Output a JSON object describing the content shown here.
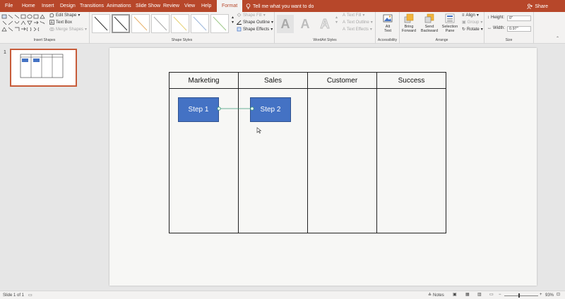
{
  "menu": {
    "tabs": [
      "File",
      "Home",
      "Insert",
      "Design",
      "Transitions",
      "Animations",
      "Slide Show",
      "Review",
      "View",
      "Help"
    ],
    "active_tab": "Format",
    "tell_me": "Tell me what you want to do",
    "share": "Share"
  },
  "ribbon": {
    "insert_shapes": {
      "label": "Insert Shapes",
      "edit_shape": "Edit Shape",
      "text_box": "Text Box",
      "merge_shapes": "Merge Shapes"
    },
    "shape_styles": {
      "label": "Shape Styles",
      "fill": "Shape Fill",
      "outline": "Shape Outline",
      "effects": "Shape Effects"
    },
    "wordart": {
      "label": "WordArt Styles",
      "letter": "A",
      "text_fill": "Text Fill",
      "text_outline": "Text Outline",
      "text_effects": "Text Effects"
    },
    "accessibility": {
      "label": "Accessibility",
      "alt_text_line1": "Alt",
      "alt_text_line2": "Text"
    },
    "arrange": {
      "label": "Arrange",
      "bring_forward_line1": "Bring",
      "bring_forward_line2": "Forward",
      "send_backward_line1": "Send",
      "send_backward_line2": "Backward",
      "selection_pane_line1": "Selection",
      "selection_pane_line2": "Pane",
      "align": "Align",
      "group": "Group",
      "rotate": "Rotate"
    },
    "size": {
      "label": "Size",
      "height_label": "Height:",
      "height_value": "0\"",
      "width_label": "Width:",
      "width_value": "0.97\""
    }
  },
  "thumbnails": {
    "slide_number": "1"
  },
  "slide": {
    "columns": [
      "Marketing",
      "Sales",
      "Customer",
      "Success"
    ],
    "steps": [
      "Step 1",
      "Step 2"
    ]
  },
  "status": {
    "slide_info": "Slide 1 of 1",
    "notes": "Notes",
    "zoom": "93%"
  },
  "colors": {
    "accent": "#b7472a",
    "step_fill": "#4472c4",
    "connector": "#3a9b79"
  }
}
